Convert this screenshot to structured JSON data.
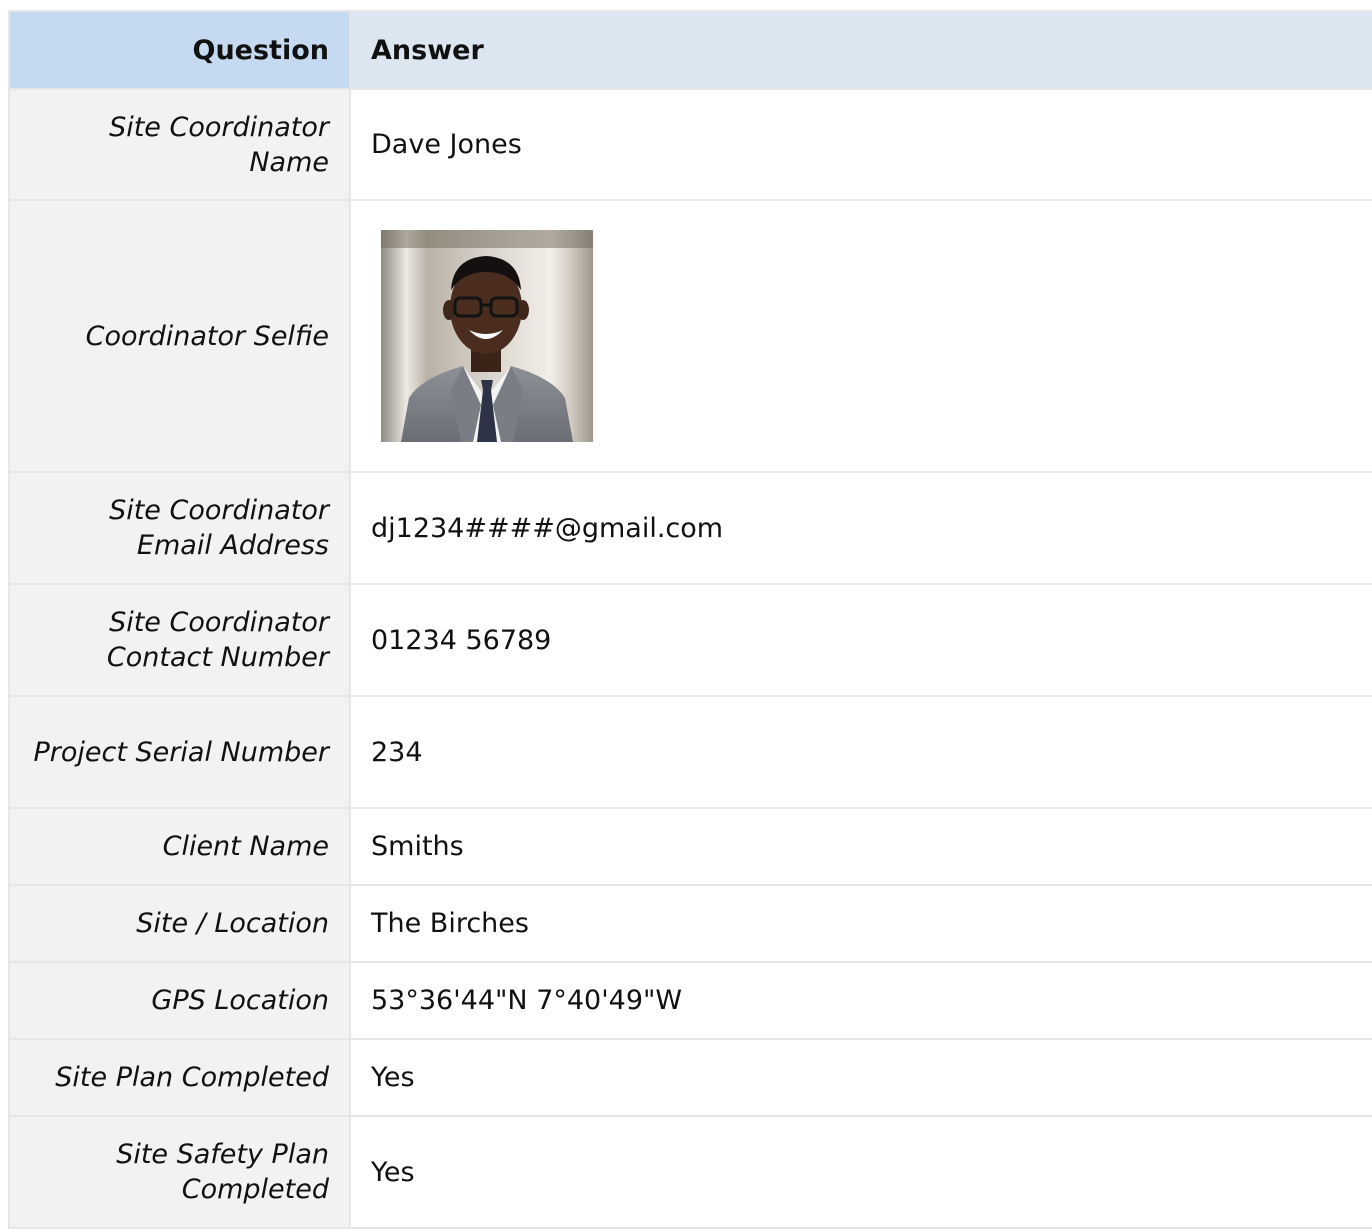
{
  "header": {
    "question": "Question",
    "answer": "Answer"
  },
  "rows": [
    {
      "question": "Site Coordinator Name",
      "answer": "Dave Jones"
    },
    {
      "question": "Coordinator Selfie",
      "answer": ""
    },
    {
      "question": "Site Coordinator Email Address",
      "answer": "dj1234####@gmail.com"
    },
    {
      "question": "Site Coordinator Contact Number",
      "answer": "01234 56789"
    },
    {
      "question": "Project Serial Number",
      "answer": "234"
    },
    {
      "question": "Client Name",
      "answer": "Smiths"
    },
    {
      "question": "Site / Location",
      "answer": "The Birches"
    },
    {
      "question": "GPS Location",
      "answer": "53°36'44\"N 7°40'49\"W"
    },
    {
      "question": "Site Plan Completed",
      "answer": "Yes"
    },
    {
      "question": "Site Safety Plan Completed",
      "answer": "Yes"
    }
  ],
  "colors": {
    "header_question_bg": "#c5d9f1",
    "header_answer_bg": "#dce6f1",
    "question_cell_bg": "#f2f2f2",
    "border": "#e6e6e6"
  }
}
